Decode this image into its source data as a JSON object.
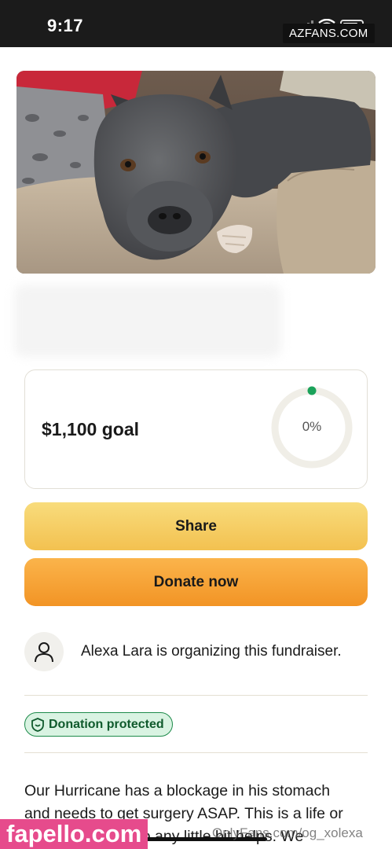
{
  "status_bar": {
    "time": "9:17",
    "icons": [
      "cellular-signal-icon",
      "wifi-icon",
      "battery-icon"
    ]
  },
  "watermarks": {
    "top": "AZFANS.COM",
    "bottom_left": "fapello.com",
    "bottom_right": "OnlyFans.com/og_xolexa"
  },
  "photo": {
    "description_icon": "dog-photo"
  },
  "goal": {
    "text": "$1,100 goal",
    "progress_percent_label": "0%",
    "progress_fraction": 0,
    "accent_color": "#1aa25a"
  },
  "buttons": {
    "share": "Share",
    "donate": "Donate now"
  },
  "organizer": {
    "text": "Alexa Lara is organizing this fundraiser.",
    "icon": "person-icon"
  },
  "badge": {
    "label": "Donation protected",
    "icon": "shield-icon",
    "color": "#1d8a4a"
  },
  "description": {
    "line1": "Our Hurricane has a blockage in his stomach",
    "line2": "and needs to get surgery ASAP. This is a life or",
    "line3": "so any little bit helps. We"
  },
  "colors": {
    "share_button": "#f5ce66",
    "donate_button": "#f5a232",
    "status_bar": "#1b1b1b"
  }
}
